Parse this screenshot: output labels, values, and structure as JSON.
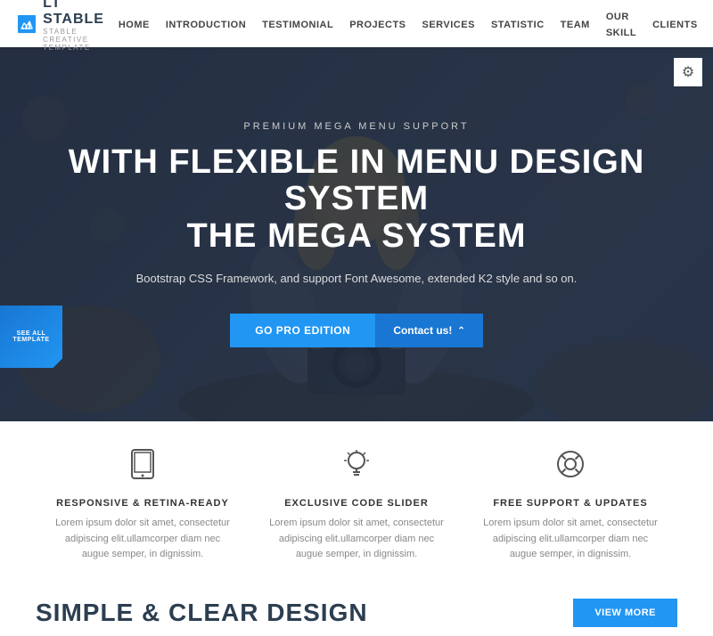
{
  "brand": {
    "logo_title": "LT STABLE",
    "logo_subtitle": "STABLE CREATIVE TEMPLATE"
  },
  "nav": {
    "links": [
      {
        "label": "HOME",
        "active": true
      },
      {
        "label": "INTRODUCTION",
        "active": false
      },
      {
        "label": "TESTIMONIAL",
        "active": false
      },
      {
        "label": "PROJECTS",
        "active": false
      },
      {
        "label": "SERVICES",
        "active": false
      },
      {
        "label": "STATISTIC",
        "active": false
      },
      {
        "label": "TEAM",
        "active": false
      },
      {
        "label": "OUR SKILL",
        "active": false
      },
      {
        "label": "CLIENTS",
        "active": false
      }
    ]
  },
  "hero": {
    "tagline": "PREMIUM MEGA MENU SUPPORT",
    "title_line1": "WITH FLEXIBLE IN MENU DESIGN SYSTEM",
    "title_line2": "THE MEGA SYSTEM",
    "subtitle": "Bootstrap CSS Framework, and support Font Awesome, extended K2 style and so on.",
    "btn_primary": "Go Pro Edition",
    "btn_secondary": "Contact us!",
    "corner_badge": "SEE ALL TEMPLATE"
  },
  "features": [
    {
      "icon": "tablet",
      "title": "RESPONSIVE & RETINA-READY",
      "desc": "Lorem ipsum dolor sit amet, consectetur adipiscing elit.ullamcorper diam nec augue semper, in dignissim."
    },
    {
      "icon": "bulb",
      "title": "EXCLUSIVE CODE SLIDER",
      "desc": "Lorem ipsum dolor sit amet, consectetur adipiscing elit.ullamcorper diam nec augue semper, in dignissim."
    },
    {
      "icon": "support",
      "title": "FREE SUPPORT & UPDATES",
      "desc": "Lorem ipsum dolor sit amet, consectetur adipiscing elit.ullamcorper diam nec augue semper, in dignissim."
    }
  ],
  "bottom": {
    "title": "SIMPLE & CLEAR DESIGN",
    "btn_label": "View More"
  }
}
